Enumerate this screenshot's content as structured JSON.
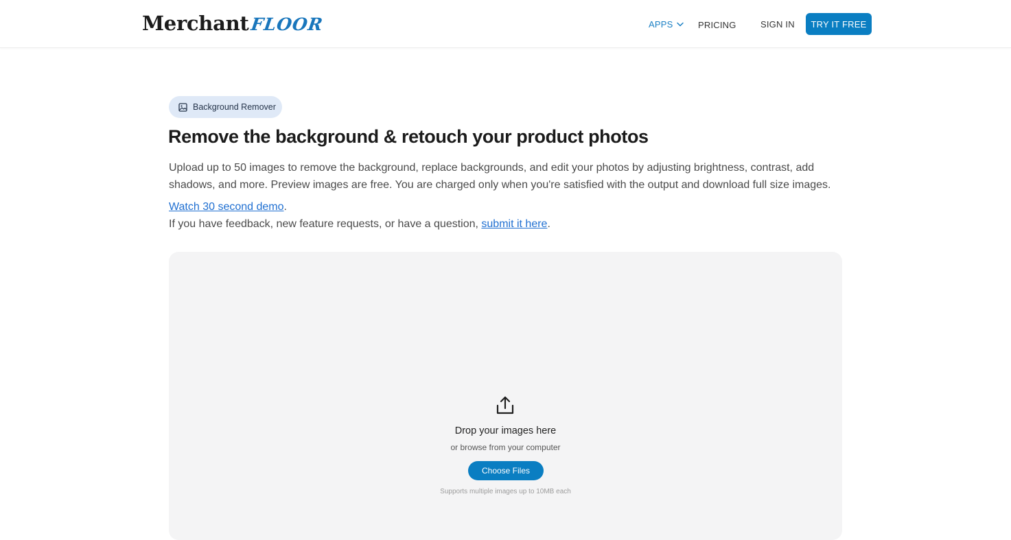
{
  "header": {
    "logo_main": "Merchant",
    "logo_accent": "FLOOR",
    "nav": {
      "apps": "APPS",
      "pricing": "PRICING",
      "sign_in": "SIGN IN",
      "try_free": "TRY IT FREE"
    }
  },
  "hero": {
    "badge_label": "Background Remover",
    "title": "Remove the background & retouch your product photos",
    "description": "Upload up to 50 images to remove the background, replace backgrounds, and edit your photos by adjusting brightness, contrast, add shadows, and more. Preview images are free. You are charged only when you're satisfied with the output and download full size images.",
    "demo_link": "Watch 30 second demo",
    "demo_suffix": ".",
    "feedback_prefix": "If you have feedback, new feature requests, or have a question, ",
    "feedback_link": "submit it here",
    "feedback_suffix": "."
  },
  "upload": {
    "title": "Drop your images here",
    "subtitle": "or browse from your computer",
    "button": "Choose Files",
    "note": "Supports multiple images up to 10MB each"
  },
  "colors": {
    "accent": "#0a7ec2",
    "link": "#1f6fd1",
    "badge_bg": "#dfe9f7",
    "dropzone_bg": "#f4f4f5"
  },
  "icons": {
    "apps_dropdown": "chevron-down-icon",
    "badge": "image-icon",
    "upload": "upload-icon"
  }
}
